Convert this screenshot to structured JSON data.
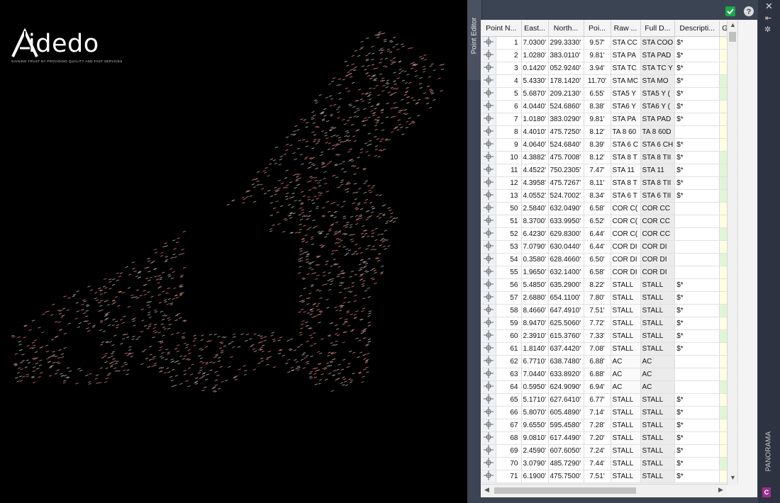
{
  "logo": {
    "name": "idedo",
    "tagline": "GAINING TRUST BY PROVIDING QUALITY AND FAST SERVICES"
  },
  "palette": {
    "title": "Point Editor",
    "panorama_label": "PANORAMA",
    "app_badge": "C",
    "toolbar": {
      "check_icon": "checkmark-icon",
      "help_icon": "help-icon",
      "close_icon": "close-icon"
    },
    "columns": [
      "Point N...",
      "East...",
      "North...",
      "Poi...",
      "Raw ...",
      "Full D...",
      "Descripti...",
      "Gric"
    ],
    "rows": [
      {
        "point": "1",
        "easting": "7.0300'",
        "northing": "299.3330'",
        "elev": "9.57'",
        "raw": "STA CC",
        "full": "STA COO",
        "desc": "$*",
        "grid": "y"
      },
      {
        "point": "2",
        "easting": "1.0280'",
        "northing": "383.0110'",
        "elev": "9.81'",
        "raw": "STA PA",
        "full": "STA PAD",
        "desc": "$*",
        "grid": "y"
      },
      {
        "point": "3",
        "easting": "0.1420'",
        "northing": "052.9240'",
        "elev": "3.94'",
        "raw": "STA TC",
        "full": "STA TC Y",
        "desc": "$*",
        "grid": "y"
      },
      {
        "point": "4",
        "easting": "5.4330'",
        "northing": "178.1420'",
        "elev": "11.70'",
        "raw": "STA MC",
        "full": "STA MO",
        "desc": "$*",
        "grid": "g"
      },
      {
        "point": "5",
        "easting": "5.6870'",
        "northing": "209.2130'",
        "elev": "6.55'",
        "raw": "STA5 Y",
        "full": "STA5 Y (",
        "desc": "$*",
        "grid": "g"
      },
      {
        "point": "6",
        "easting": "4.0440'",
        "northing": "524.6860'",
        "elev": "8.38'",
        "raw": "STA6 Y",
        "full": "STA6 Y (",
        "desc": "$*",
        "grid": "y"
      },
      {
        "point": "7",
        "easting": "1.0180'",
        "northing": "383.0290'",
        "elev": "9.81'",
        "raw": "STA PA",
        "full": "STA PAD",
        "desc": "$*",
        "grid": "y"
      },
      {
        "point": "8",
        "easting": "4.4010'",
        "northing": "475.7250'",
        "elev": "8.12'",
        "raw": "TA 8 60",
        "full": "TA 8 60D",
        "desc": "",
        "grid": "y"
      },
      {
        "point": "9",
        "easting": "4.0640'",
        "northing": "524.6840'",
        "elev": "8.39'",
        "raw": "STA 6 C",
        "full": "STA 6 CH",
        "desc": "$*",
        "grid": "y"
      },
      {
        "point": "10",
        "easting": "4.3882'",
        "northing": "475.7008'",
        "elev": "8.12'",
        "raw": "STA 8 T",
        "full": "STA 8 TII",
        "desc": "$*",
        "grid": "g"
      },
      {
        "point": "11",
        "easting": "4.4522'",
        "northing": "750.2305'",
        "elev": "7.47'",
        "raw": "STA 11",
        "full": "STA 11",
        "desc": "$*",
        "grid": "g"
      },
      {
        "point": "12",
        "easting": "4.3958'",
        "northing": "475.7267'",
        "elev": "8.11'",
        "raw": "STA 8 T",
        "full": "STA 8 TII",
        "desc": "$*",
        "grid": "g"
      },
      {
        "point": "13",
        "easting": "4.0552'",
        "northing": "524.7002'",
        "elev": "8.34'",
        "raw": "STA 6 T",
        "full": "STA 6 TII",
        "desc": "$*",
        "grid": "g"
      },
      {
        "point": "50",
        "easting": "2.5840'",
        "northing": "632.0490'",
        "elev": "6.58'",
        "raw": "COR C(",
        "full": "COR CC",
        "desc": "",
        "grid": "y"
      },
      {
        "point": "51",
        "easting": "8.3700'",
        "northing": "633.9950'",
        "elev": "6.52'",
        "raw": "COR C(",
        "full": "COR CC",
        "desc": "",
        "grid": "y"
      },
      {
        "point": "52",
        "easting": "6.4230'",
        "northing": "629.8300'",
        "elev": "6.44'",
        "raw": "COR C(",
        "full": "COR CC",
        "desc": "",
        "grid": "g"
      },
      {
        "point": "53",
        "easting": "7.0790'",
        "northing": "630.0440'",
        "elev": "6.44'",
        "raw": "COR DI",
        "full": "COR DI",
        "desc": "",
        "grid": "y"
      },
      {
        "point": "54",
        "easting": "0.3580'",
        "northing": "628.4660'",
        "elev": "6.50'",
        "raw": "COR DI",
        "full": "COR DI",
        "desc": "",
        "grid": "g"
      },
      {
        "point": "55",
        "easting": "1.9650'",
        "northing": "632.1400'",
        "elev": "6.58'",
        "raw": "COR DI",
        "full": "COR DI",
        "desc": "",
        "grid": "y"
      },
      {
        "point": "56",
        "easting": "5.4850'",
        "northing": "635.2900'",
        "elev": "8.22'",
        "raw": "STALL",
        "full": "STALL",
        "desc": "$*",
        "grid": "y"
      },
      {
        "point": "57",
        "easting": "2.6880'",
        "northing": "654.1100'",
        "elev": "7.80'",
        "raw": "STALL",
        "full": "STALL",
        "desc": "$*",
        "grid": "y"
      },
      {
        "point": "58",
        "easting": "8.4660'",
        "northing": "647.4910'",
        "elev": "7.51'",
        "raw": "STALL",
        "full": "STALL",
        "desc": "$*",
        "grid": "g"
      },
      {
        "point": "59",
        "easting": "8.9470'",
        "northing": "625.5060'",
        "elev": "7.72'",
        "raw": "STALL",
        "full": "STALL",
        "desc": "$*",
        "grid": "y"
      },
      {
        "point": "60",
        "easting": "2.3910'",
        "northing": "615.3760'",
        "elev": "7.33'",
        "raw": "STALL",
        "full": "STALL",
        "desc": "$*",
        "grid": "g"
      },
      {
        "point": "61",
        "easting": "1.8140'",
        "northing": "637.4420'",
        "elev": "7.08'",
        "raw": "STALL",
        "full": "STALL",
        "desc": "$*",
        "grid": "y"
      },
      {
        "point": "62",
        "easting": "6.7710'",
        "northing": "638.7480'",
        "elev": "6.88'",
        "raw": "AC",
        "full": "AC",
        "desc": "",
        "grid": "y"
      },
      {
        "point": "63",
        "easting": "7.0440'",
        "northing": "633.8920'",
        "elev": "6.88'",
        "raw": "AC",
        "full": "AC",
        "desc": "",
        "grid": "y"
      },
      {
        "point": "64",
        "easting": "0.5950'",
        "northing": "624.9090'",
        "elev": "6.94'",
        "raw": "AC",
        "full": "AC",
        "desc": "",
        "grid": "g"
      },
      {
        "point": "65",
        "easting": "5.1710'",
        "northing": "627.6410'",
        "elev": "6.77'",
        "raw": "STALL",
        "full": "STALL",
        "desc": "$*",
        "grid": "y"
      },
      {
        "point": "66",
        "easting": "5.8070'",
        "northing": "605.4890'",
        "elev": "7.14'",
        "raw": "STALL",
        "full": "STALL",
        "desc": "$*",
        "grid": "g"
      },
      {
        "point": "67",
        "easting": "9.6550'",
        "northing": "595.4580'",
        "elev": "7.28'",
        "raw": "STALL",
        "full": "STALL",
        "desc": "$*",
        "grid": "y"
      },
      {
        "point": "68",
        "easting": "9.0810'",
        "northing": "617.4490'",
        "elev": "7.20'",
        "raw": "STALL",
        "full": "STALL",
        "desc": "$*",
        "grid": "y"
      },
      {
        "point": "69",
        "easting": "2.4590'",
        "northing": "607.6050'",
        "elev": "7.24'",
        "raw": "STALL",
        "full": "STALL",
        "desc": "$*",
        "grid": "y"
      },
      {
        "point": "70",
        "easting": "3.0790'",
        "northing": "485.7290'",
        "elev": "7.44'",
        "raw": "STALL",
        "full": "STALL",
        "desc": "$*",
        "grid": "g"
      },
      {
        "point": "71",
        "easting": "6.1900'",
        "northing": "475.7500'",
        "elev": "7.51'",
        "raw": "STALL",
        "full": "STALL",
        "desc": "$*",
        "grid": "y"
      }
    ]
  }
}
